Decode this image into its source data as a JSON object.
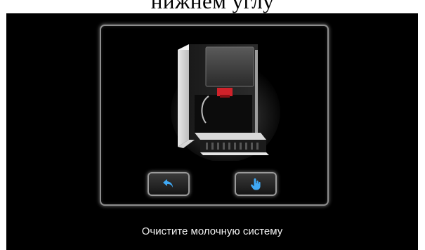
{
  "header": {
    "caption": "нижнем углу"
  },
  "panel": {
    "image_icon": "coffee-machine-image",
    "buttons": [
      {
        "icon": "undo-arrow-icon",
        "color": "#3fa9f5"
      },
      {
        "icon": "hand-tap-icon",
        "color": "#3fa9f5"
      }
    ]
  },
  "status": {
    "message": "Очистите молочную систему"
  },
  "colors": {
    "background": "#000000",
    "accent": "#3fa9f5",
    "border": "#9a9a9a",
    "machine_red": "#d0222a"
  }
}
